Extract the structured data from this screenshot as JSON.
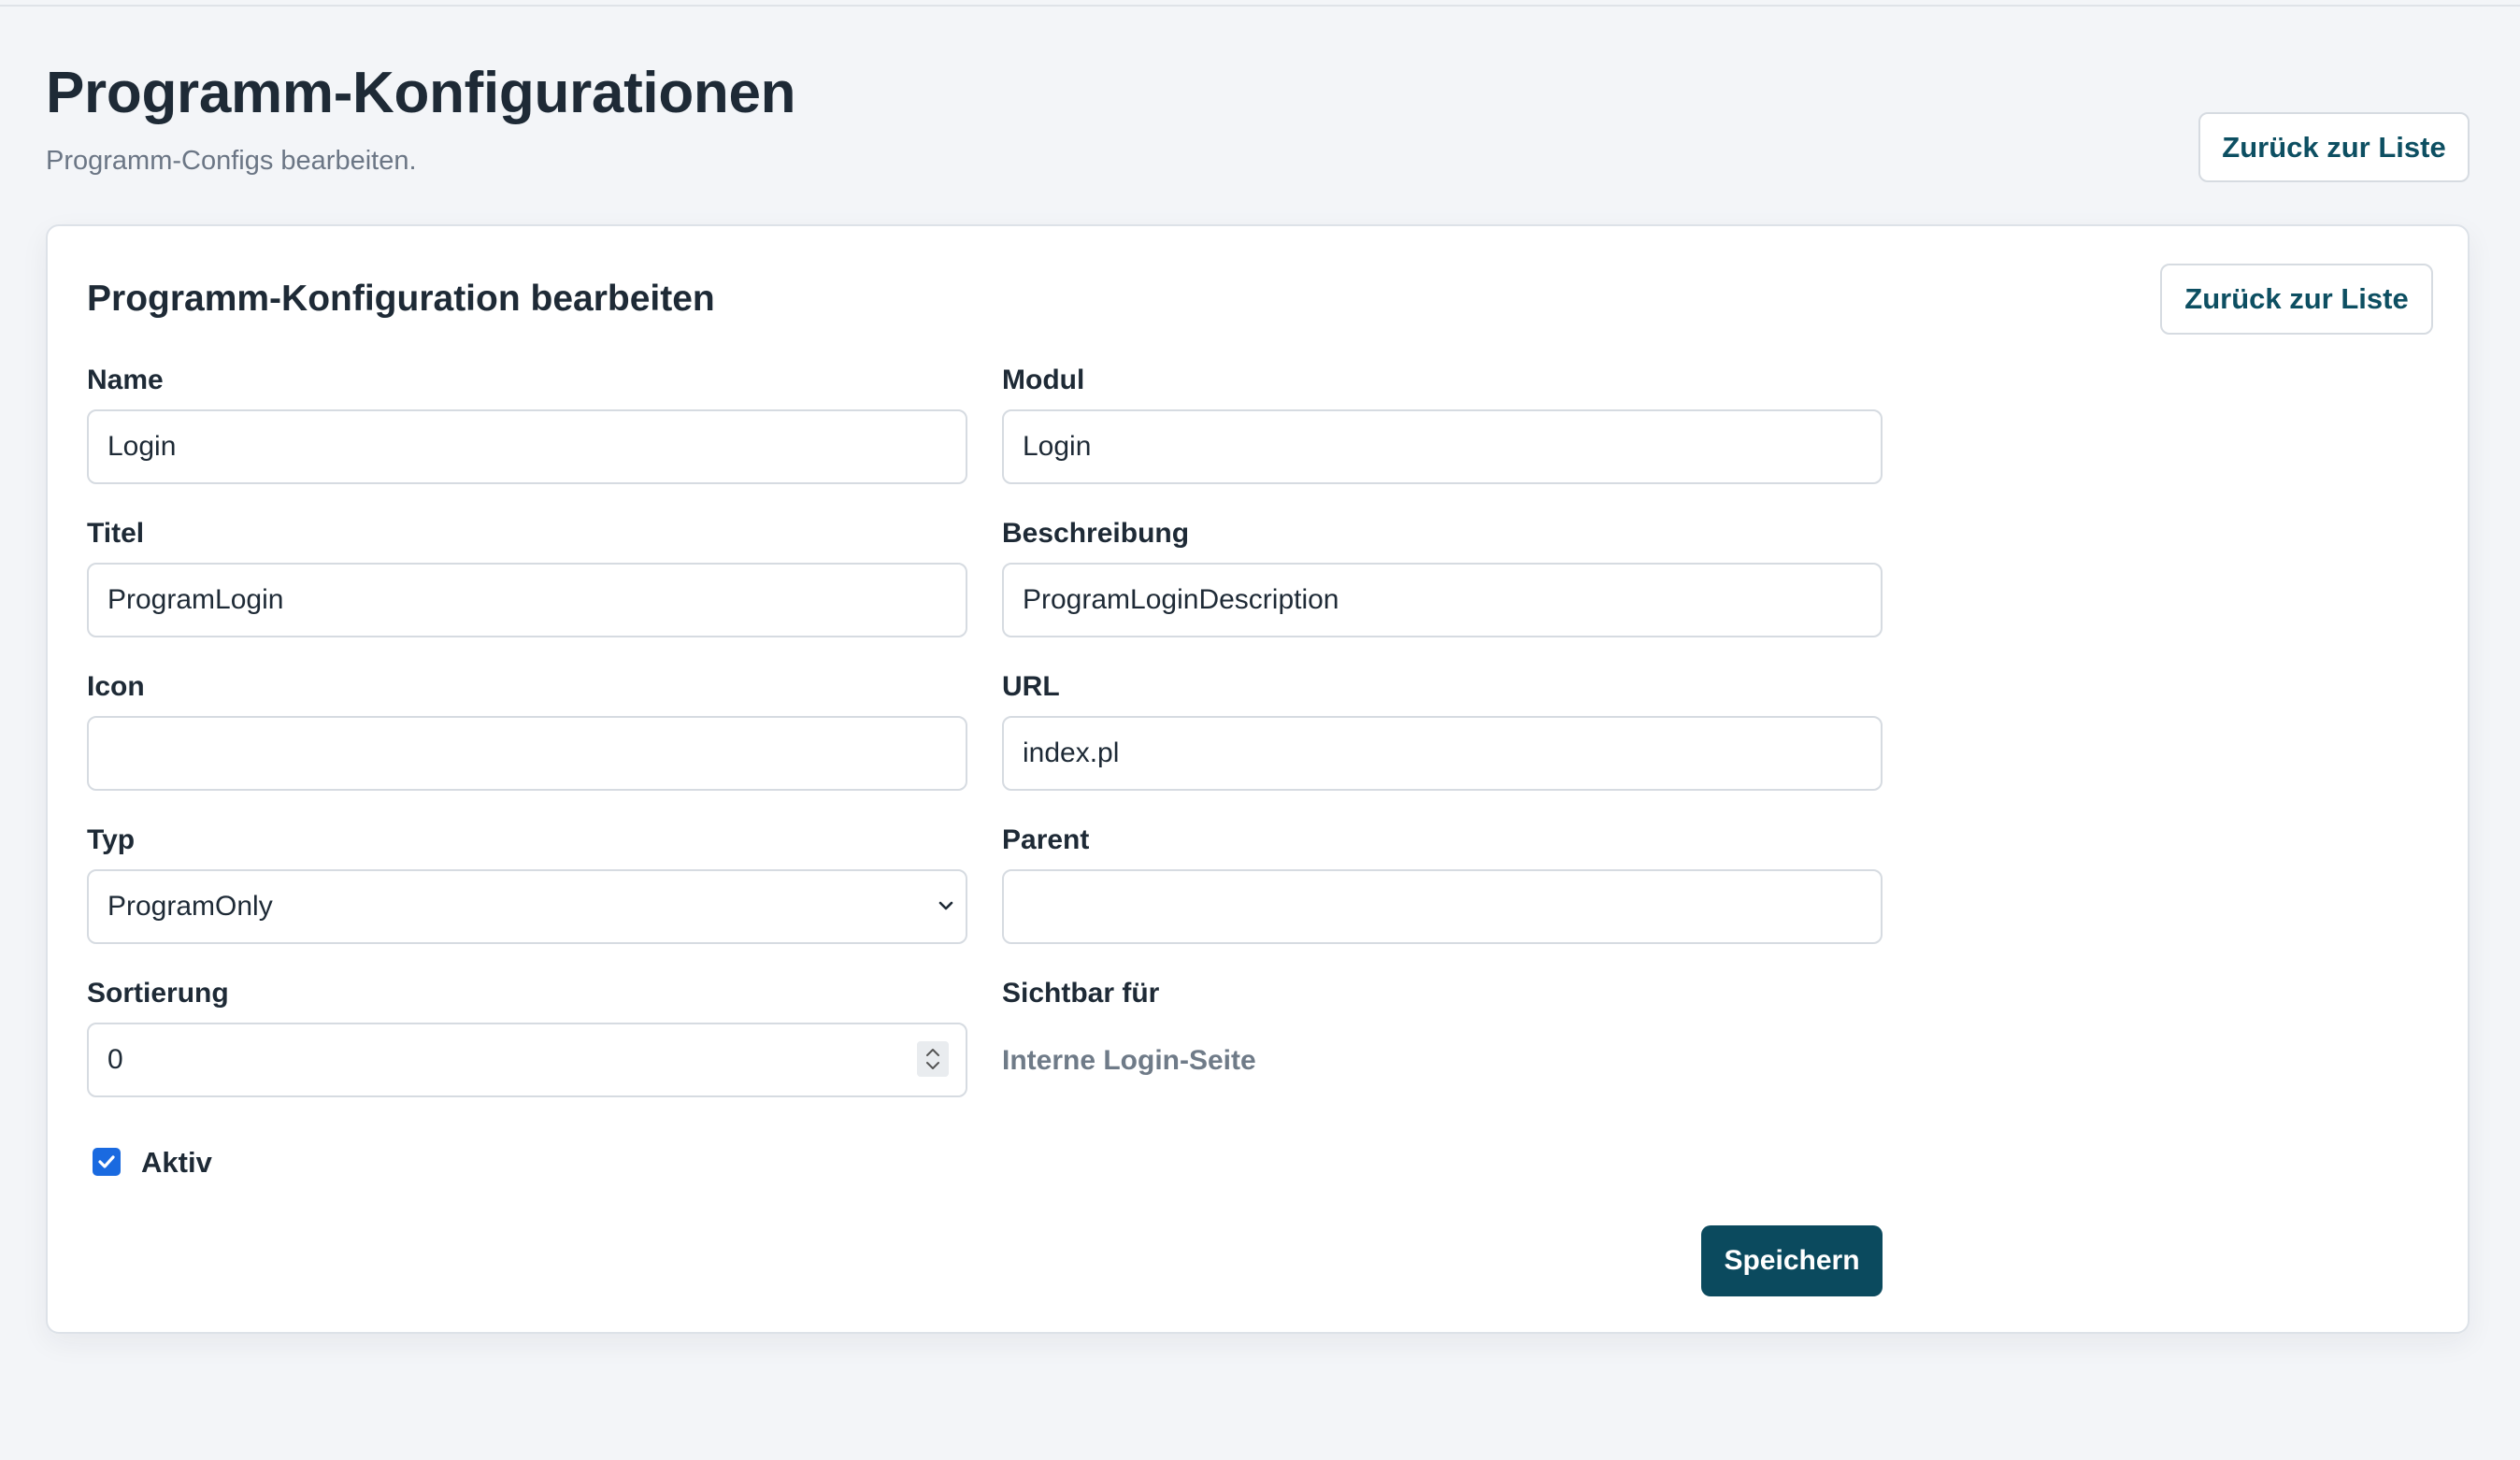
{
  "header": {
    "title": "Programm-Konfigurationen",
    "subtitle": "Programm-Configs bearbeiten.",
    "back_label": "Zurück zur Liste"
  },
  "card": {
    "title": "Programm-Konfiguration bearbeiten",
    "back_label": "Zurück zur Liste"
  },
  "form": {
    "name": {
      "label": "Name",
      "value": "Login"
    },
    "modul": {
      "label": "Modul",
      "value": "Login"
    },
    "titel": {
      "label": "Titel",
      "value": "ProgramLogin"
    },
    "beschreibung": {
      "label": "Beschreibung",
      "value": "ProgramLoginDescription"
    },
    "icon": {
      "label": "Icon",
      "value": ""
    },
    "url": {
      "label": "URL",
      "value": "index.pl"
    },
    "typ": {
      "label": "Typ",
      "value": "ProgramOnly"
    },
    "parent": {
      "label": "Parent",
      "value": ""
    },
    "sortierung": {
      "label": "Sortierung",
      "value": "0"
    },
    "sichtbar": {
      "label": "Sichtbar für",
      "value": "Interne Login-Seite"
    },
    "aktiv": {
      "label": "Aktiv",
      "checked": true
    },
    "save_label": "Speichern"
  },
  "colors": {
    "accent": "#0b4a5e",
    "link": "#0d4f62",
    "checkbox": "#1a6ae0",
    "background": "#f3f5f8"
  },
  "icons": {
    "select": "chevron-down-icon",
    "number": "spinner-icon",
    "checkbox": "checkmark-icon"
  }
}
